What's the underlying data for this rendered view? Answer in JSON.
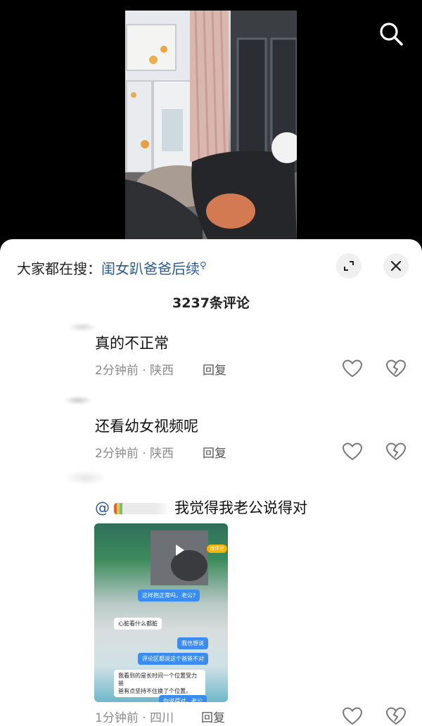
{
  "header": {
    "search_prefix": "大家都在搜：",
    "search_term": "闺女趴爸爸后续",
    "comment_count_title": "3237条评论"
  },
  "icons": {
    "search": "search-icon",
    "expand": "expand-icon",
    "close": "close-icon",
    "like": "heart-outline-icon",
    "dislike": "broken-heart-icon",
    "play": "play-icon"
  },
  "comments": [
    {
      "text": "真的不正常",
      "meta": "2分钟前 · 陕西",
      "reply": "回复"
    },
    {
      "text": "还看幼女视频呢",
      "meta": "2分钟前 · 陕西",
      "reply": "回复"
    },
    {
      "mention_prefix": "@",
      "text": "我觉得我老公说得对",
      "meta": "1分钟前 · 四川",
      "reply": "回复",
      "attachment": {
        "badge": "待评论",
        "bubble_1": "这样抱正常吗，老公?",
        "bubble_2": "心脏看什么都脏",
        "bubble_3": "我也想说",
        "bubble_4": "评论区都说这个爸爸不对",
        "bubble_5_line1": "我看到的是长时间一个位置受力爸",
        "bubble_5_line2": "爸有点坚持不住换了个位置。",
        "bubble_6": "你说得对，老公"
      }
    }
  ],
  "colors": {
    "link_blue": "#2a5a96",
    "meta_gray": "#8a8a8a",
    "sheet_bg": "#ffffff",
    "video_bg": "#000000"
  }
}
